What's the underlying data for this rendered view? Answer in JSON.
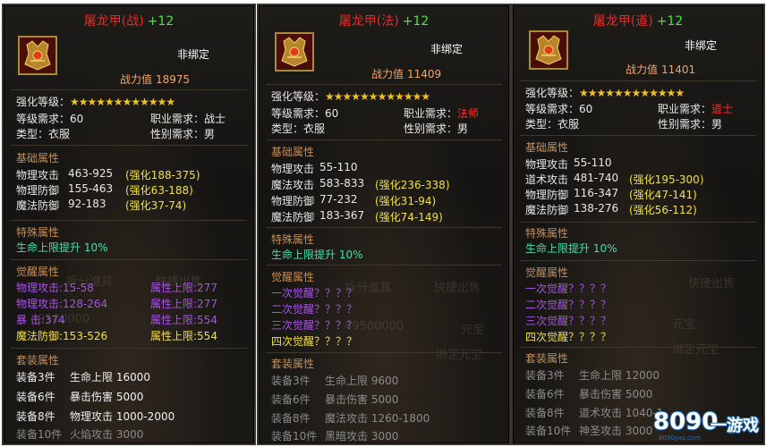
{
  "panels": [
    {
      "title": "屠龙甲(战)",
      "plus": "+12",
      "bind": "非绑定",
      "power_label": "战力值",
      "power_value": "18975",
      "enhance_label": "强化等级：",
      "stars": "★★★★★★★★★★★★",
      "level_req": "等级需求：60",
      "job_label": "职业需求：",
      "job_value": "战士",
      "type": "类型：衣服",
      "gender": "性别需求：男",
      "base_title": "基础属性",
      "base": [
        {
          "name": "物理攻击",
          "val": "463-925",
          "bonus": "(强化188-375)"
        },
        {
          "name": "物理防御",
          "val": "155-463",
          "bonus": "(强化63-188)"
        },
        {
          "name": "魔法防御",
          "val": "92-183",
          "bonus": "(强化37-74)"
        }
      ],
      "special_title": "特殊属性",
      "special": "生命上限提升  10%",
      "awaken_title": "觉醒属性",
      "awaken": [
        {
          "left": "物理攻击:15-58",
          "right": "属性上限:277"
        },
        {
          "left": "物理攻击:128-264",
          "right": "属性上限:277"
        },
        {
          "left": "暴      击:374",
          "right": "属性上限:554"
        },
        {
          "left": "魔法防御:153-526",
          "right": "属性上限:554"
        }
      ],
      "set_title": "套装属性",
      "set": [
        {
          "count": "装备3件",
          "attr": "生命上限  16000"
        },
        {
          "count": "装备6件",
          "attr": "暴击伤害  5000"
        },
        {
          "count": "装备8件",
          "attr": "物理攻击  1000-2000"
        },
        {
          "count": "装备10件",
          "attr": "火焰攻击  3000"
        }
      ]
    },
    {
      "title": "屠龙甲(法)",
      "plus": "+12",
      "bind": "非绑定",
      "power_label": "战力值",
      "power_value": "11409",
      "enhance_label": "强化等级：",
      "stars": "★★★★★★★★★★★★",
      "level_req": "等级需求：60",
      "job_label": "职业需求：",
      "job_value": "法师",
      "type": "类型：衣服",
      "gender": "性别需求：男",
      "base_title": "基础属性",
      "base": [
        {
          "name": "物理攻击",
          "val": "55-110",
          "bonus": ""
        },
        {
          "name": "魔法攻击",
          "val": "583-833",
          "bonus": "(强化236-338)"
        },
        {
          "name": "物理防御",
          "val": "77-232",
          "bonus": "(强化31-94)"
        },
        {
          "name": "魔法防御",
          "val": "183-367",
          "bonus": "(强化74-149)"
        }
      ],
      "special_title": "特殊属性",
      "special": "生命上限提升  10%",
      "awaken_title": "觉醒属性",
      "awaken": [
        {
          "left": "一次觉醒？？？？",
          "right": ""
        },
        {
          "left": "二次觉醒？？？？",
          "right": ""
        },
        {
          "left": "三次觉醒？？？？",
          "right": ""
        },
        {
          "left": "四次觉醒？？？？",
          "right": ""
        }
      ],
      "set_title": "套装属性",
      "set": [
        {
          "count": "装备3件",
          "attr": "生命上限  9600"
        },
        {
          "count": "装备6件",
          "attr": "暴击伤害  5000"
        },
        {
          "count": "装备8件",
          "attr": "魔法攻击  1260-1800"
        },
        {
          "count": "装备10件",
          "attr": "黑暗攻击  3000"
        }
      ]
    },
    {
      "title": "屠龙甲(道)",
      "plus": "+12",
      "bind": "非绑定",
      "power_label": "战力值",
      "power_value": "11401",
      "enhance_label": "强化等级：",
      "stars": "★★★★★★★★★★★★",
      "level_req": "等级需求：60",
      "job_label": "职业需求：",
      "job_value": "道士",
      "type": "类型：衣服",
      "gender": "性别需求：男",
      "base_title": "基础属性",
      "base": [
        {
          "name": "物理攻击",
          "val": "55-110",
          "bonus": ""
        },
        {
          "name": "道术攻击",
          "val": "481-740",
          "bonus": "(强化195-300)"
        },
        {
          "name": "物理防御",
          "val": "116-347",
          "bonus": "(强化47-141)"
        },
        {
          "name": "魔法防御",
          "val": "138-276",
          "bonus": "(强化56-112)"
        }
      ],
      "special_title": "特殊属性",
      "special": "生命上限提升  10%",
      "awaken_title": "觉醒属性",
      "awaken": [
        {
          "left": "一次觉醒？？？？",
          "right": ""
        },
        {
          "left": "二次觉醒？？？？",
          "right": ""
        },
        {
          "left": "三次觉醒？？？？",
          "right": ""
        },
        {
          "left": "四次觉醒？？？？",
          "right": ""
        }
      ],
      "set_title": "套装属性",
      "set": [
        {
          "count": "装备3件",
          "attr": "生命上限  12000"
        },
        {
          "count": "装备6件",
          "attr": "暴击伤害  5000"
        },
        {
          "count": "装备8件",
          "attr": "道术攻击  1040-1"
        },
        {
          "count": "装备10件",
          "attr": "神圣攻击  3000"
        }
      ]
    }
  ],
  "background_text": {
    "split": "拆分道具",
    "quick_sell": "快捷出售",
    "amount": "49500000",
    "yuanbao": "元宝",
    "bound_yuanbao": "绑定元宝"
  },
  "watermark": {
    "text": "8090",
    "sub": "一游戏",
    "url": "8090yxs.com"
  },
  "colors": {
    "title_red": "#e12b2b",
    "plus_green": "#43e643",
    "star_gold": "#f2c11b",
    "section_tan": "#c48f57",
    "bonus_yellow": "#f0e040",
    "awaken_purple": "#a852e8",
    "special_cyan": "#3ee0a8"
  }
}
